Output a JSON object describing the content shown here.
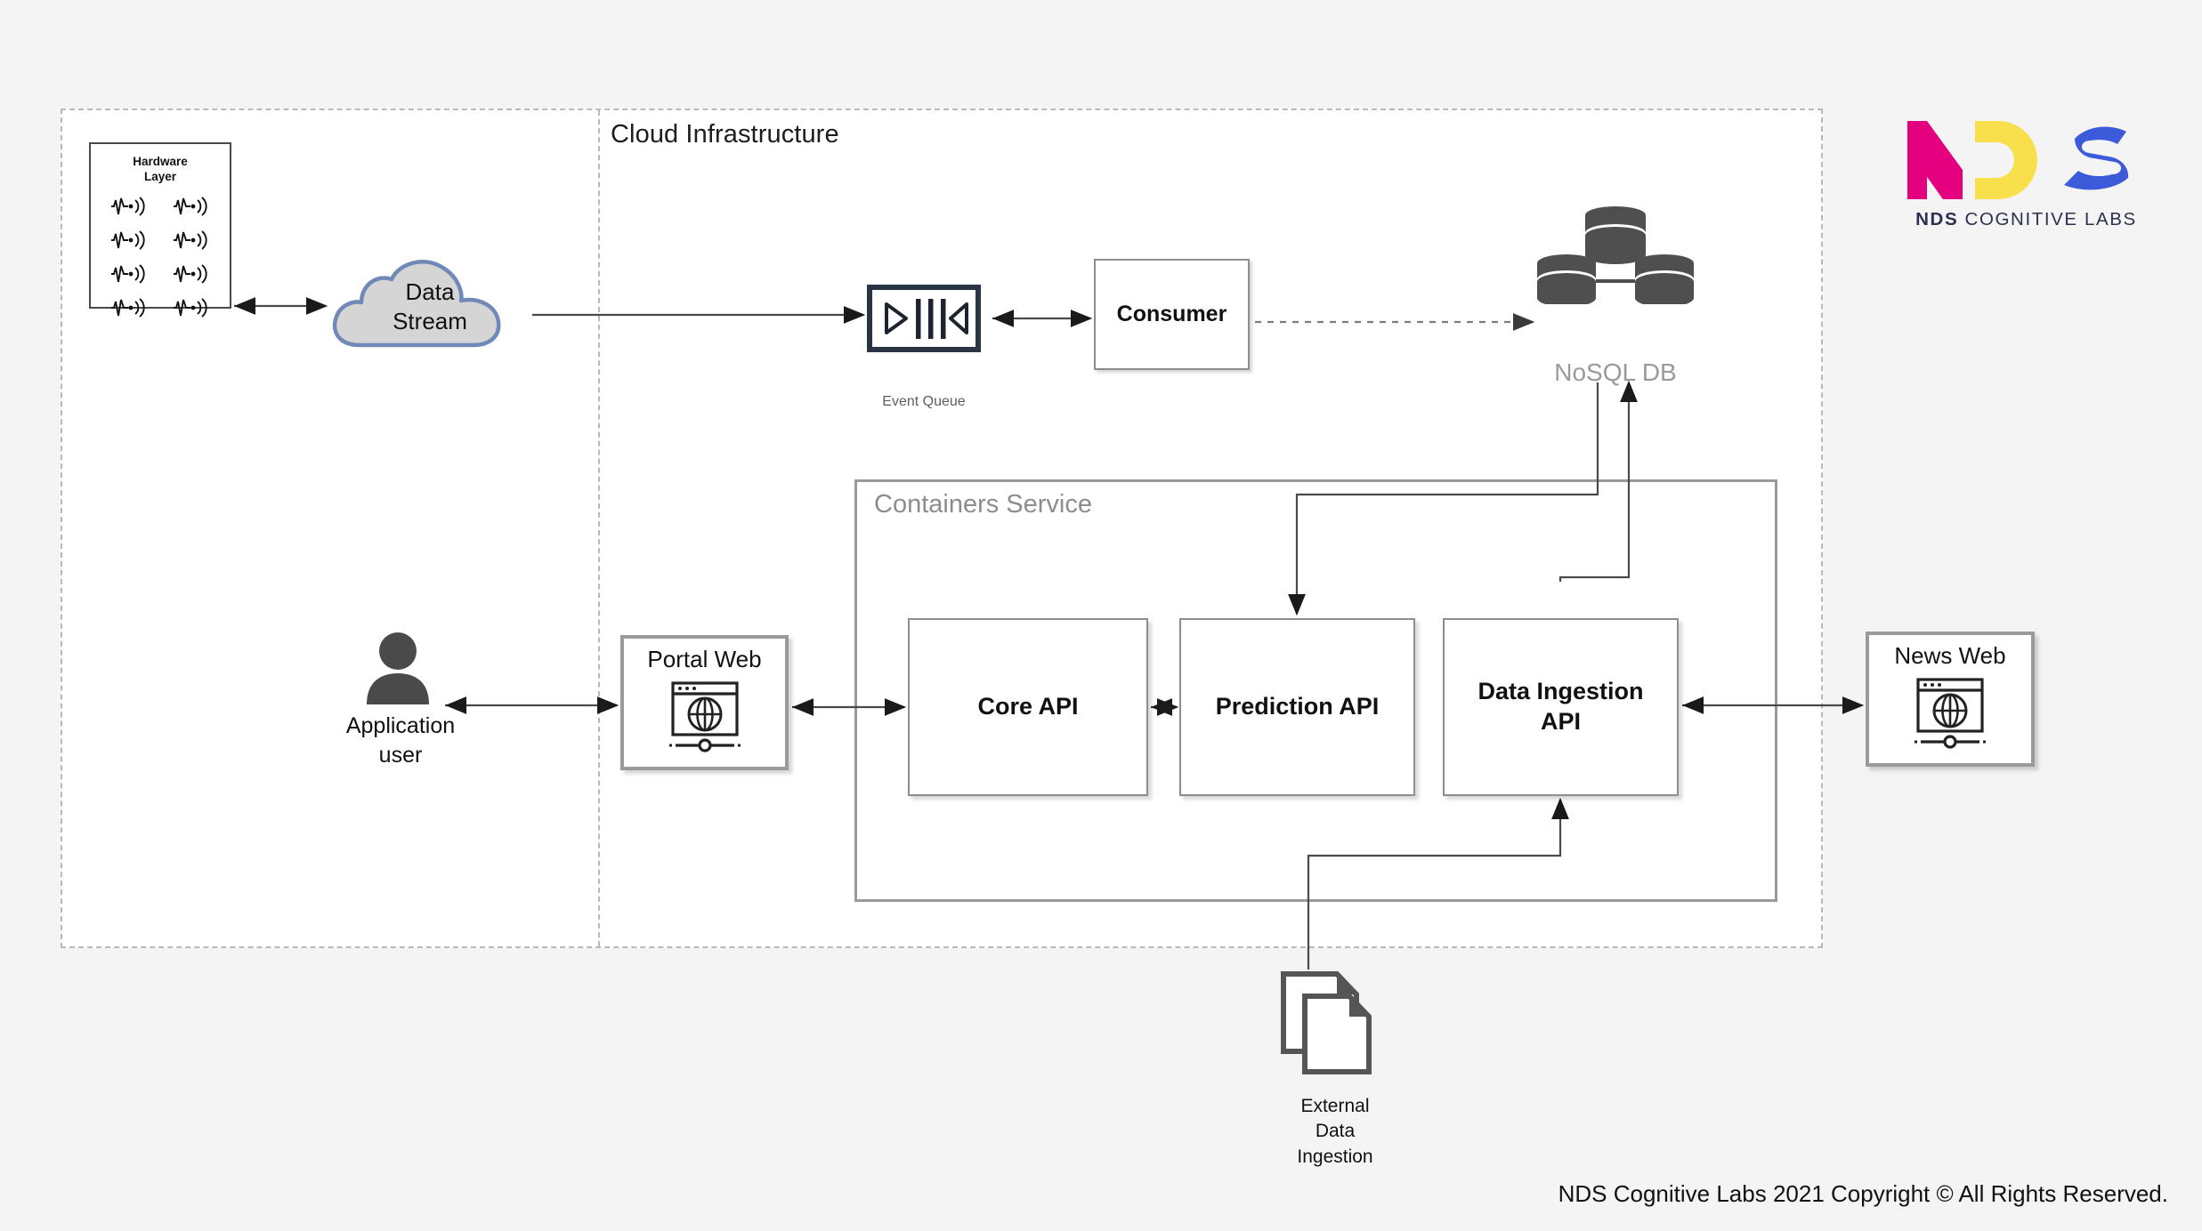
{
  "zones": {
    "cloud_label": "Cloud Infrastructure",
    "containers_label": "Containers Service"
  },
  "hardware": {
    "title_line1": "Hardware",
    "title_line2": "Layer",
    "sensor_count": 8,
    "sensor_icon": "sensor-signal-icon"
  },
  "nodes": {
    "data_stream": {
      "line1": "Data",
      "line2": "Stream",
      "icon": "cloud-icon",
      "fill": "#d5d5d5",
      "stroke": "#7089b8"
    },
    "event_queue": {
      "label": "Event Queue",
      "icon": "queue-icon",
      "color": "#2b3442"
    },
    "consumer": {
      "label": "Consumer"
    },
    "nosql_db": {
      "label": "NoSQL DB",
      "icon": "database-cluster-icon",
      "color": "#4f4f4f"
    },
    "application_user": {
      "line1": "Application",
      "line2": "user",
      "icon": "user-icon"
    },
    "portal_web": {
      "label": "Portal Web",
      "icon": "browser-globe-icon"
    },
    "news_web": {
      "label": "News Web",
      "icon": "browser-globe-icon"
    },
    "core_api": {
      "label": "Core API"
    },
    "prediction_api": {
      "label": "Prediction API"
    },
    "data_ingestion_api": {
      "line1": "Data Ingestion",
      "line2": "API"
    },
    "external_data_ingestion": {
      "line1": "External",
      "line2": "Data",
      "line3": "Ingestion",
      "icon": "documents-icon"
    }
  },
  "logo": {
    "letters": [
      {
        "glyph": "N",
        "color": "#e4007f"
      },
      {
        "glyph": "D",
        "color": "#f7e04b"
      },
      {
        "glyph": "S",
        "color": "#3b5bdb"
      }
    ],
    "wordmark_bold": "NDS",
    "wordmark_rest": " COGNITIVE LABS",
    "wordmark_color": "#2c3150"
  },
  "footer": {
    "text": "NDS Cognitive Labs 2021 Copyright © All Rights Reserved."
  },
  "connections": [
    {
      "from": "hardware_layer",
      "to": "data_stream",
      "style": "solid",
      "arrows": "both"
    },
    {
      "from": "data_stream",
      "to": "event_queue",
      "style": "solid",
      "arrows": "end"
    },
    {
      "from": "event_queue",
      "to": "consumer",
      "style": "solid",
      "arrows": "both"
    },
    {
      "from": "consumer",
      "to": "nosql_db",
      "style": "dashed",
      "arrows": "end"
    },
    {
      "from": "nosql_db",
      "to": "prediction_api",
      "style": "solid",
      "arrows": "end"
    },
    {
      "from": "data_ingestion_api",
      "to": "nosql_db",
      "style": "solid",
      "arrows": "end"
    },
    {
      "from": "application_user",
      "to": "portal_web",
      "style": "solid",
      "arrows": "both"
    },
    {
      "from": "portal_web",
      "to": "core_api",
      "style": "solid",
      "arrows": "both"
    },
    {
      "from": "core_api",
      "to": "prediction_api",
      "style": "solid",
      "arrows": "both"
    },
    {
      "from": "news_web",
      "to": "data_ingestion_api",
      "style": "solid",
      "arrows": "both"
    },
    {
      "from": "external_data_ingestion",
      "to": "data_ingestion_api",
      "style": "solid",
      "arrows": "end"
    }
  ]
}
